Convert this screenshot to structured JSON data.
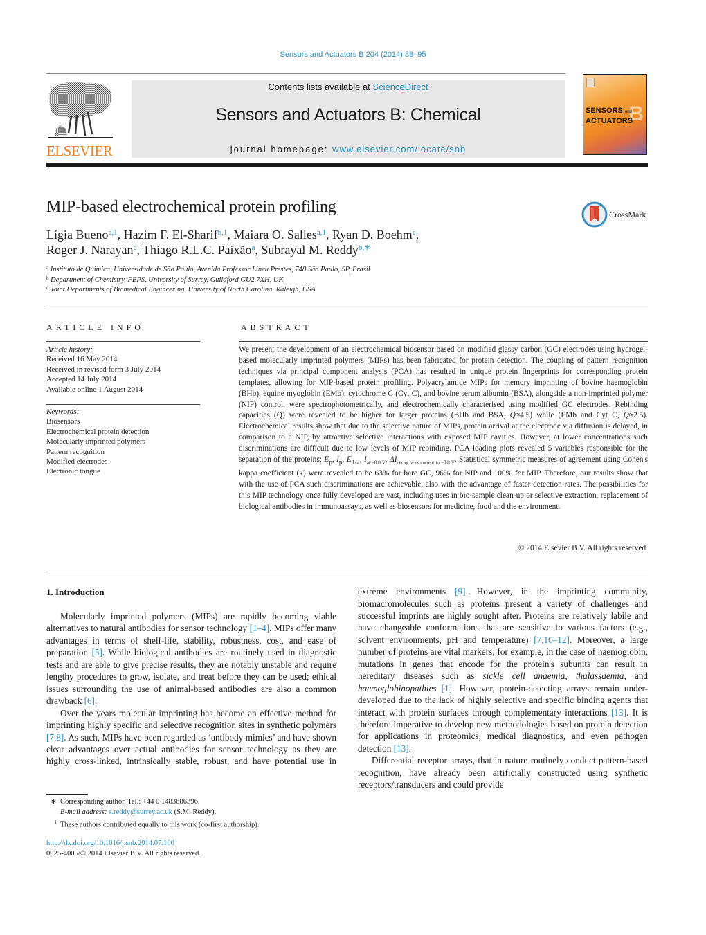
{
  "header": {
    "citation": "Sensors and Actuators B 204 (2014) 88–95",
    "contents_prefix": "Contents lists available at ",
    "contents_link": "ScienceDirect",
    "journal_title": "Sensors and Actuators B: Chemical",
    "homepage_prefix": "journal homepage: ",
    "homepage_link": "www.elsevier.com/locate/snb",
    "publisher_logo_text": "ELSEVIER",
    "cover": {
      "line1": "SENSORS",
      "line1_small": "and",
      "line2": "ACTUATORS",
      "letter": "B"
    },
    "colors": {
      "link": "#2a8fbf",
      "elsevier_orange": "#f07d1e",
      "header_box": "#e8e8e8"
    }
  },
  "article": {
    "title": "MIP-based electrochemical protein profiling",
    "crossmark_label": "CrossMark",
    "authors": [
      {
        "name": "Lígia Bueno",
        "sup": "a,1",
        "sep": ", "
      },
      {
        "name": "Hazim F. El-Sharif",
        "sup": "b,1",
        "sep": ", "
      },
      {
        "name": "Maiara O. Salles",
        "sup": "a,1",
        "sep": ", "
      },
      {
        "name": "Ryan D. Boehm",
        "sup": "c",
        "sep": ","
      },
      {
        "name": "Roger J. Narayan",
        "sup": "c",
        "sep": ", "
      },
      {
        "name": "Thiago R.L.C. Paixão",
        "sup": "a",
        "sep": ", "
      },
      {
        "name": "Subrayal M. Reddy",
        "sup": "b,∗",
        "sep": ""
      }
    ],
    "affiliations": [
      {
        "key": "a",
        "text": "Instituto de Quimica, Universidade de São Paulo, Avenida Professor Lineu Prestes, 748 São Paulo, SP, Brasil"
      },
      {
        "key": "b",
        "text": "Department of Chemistry, FEPS, University of Surrey, Guildford GU2 7XH, UK"
      },
      {
        "key": "c",
        "text": "Joint Departments of Biomedical Engineering, University of North Carolina, Raleigh, USA"
      }
    ]
  },
  "article_info": {
    "heading": "ARTICLE INFO",
    "history_label": "Article history:",
    "history": [
      "Received 16 May 2014",
      "Received in revised form 3 July 2014",
      "Accepted 14 July 2014",
      "Available online 1 August 2014"
    ],
    "keywords_label": "Keywords:",
    "keywords": [
      "Biosensors",
      "Electrochemical protein detection",
      "Molecularly imprinted polymers",
      "Pattern recognition",
      "Modified electrodes",
      "Electronic tongue"
    ]
  },
  "abstract": {
    "heading": "ABSTRACT",
    "part1": "We present the development of an electrochemical biosensor based on modified glassy carbon (GC) electrodes using hydrogel-based molecularly imprinted polymers (MIPs) has been fabricated for protein detection. The coupling of pattern recognition techniques via principal component analysis (PCA) has resulted in unique protein fingerprints for corresponding protein templates, allowing for MIP-based protein profiling. Polyacrylamide MIPs for memory imprinting of bovine haemoglobin (BHb), equine myoglobin (EMb), cytochrome C (Cyt C), and bovine serum albumin (BSA), alongside a non-imprinted polymer (NIP) control, were spectrophotometrically, and electrochemically characterised using modified GC electrodes. Rebinding capacities (Q) were revealed to be higher for larger proteins (BHb and BSA, ",
    "q1": "Q",
    "q1_val": "≈4.5) while (EMb and Cyt C, ",
    "q2": "Q",
    "q2_val": "≈2.5). Electrochemical results show that due to the selective nature of MIPs, protein arrival at the electrode via diffusion is delayed, in comparison to a NIP, by attractive selective interactions with exposed MIP cavities. However, at lower concentrations such discriminations are difficult due to low levels of MIP rebinding. PCA loading plots revealed 5 variables responsible for the separation of the proteins; ",
    "vars": {
      "ep": "E",
      "ep_sub": "p",
      "ip": "I",
      "ip_sub": "p",
      "e12": "E",
      "e12_sub": "1/2",
      "iat": "I",
      "iat_sub": "at −0.8 V",
      "di": "ΔI",
      "di_sub": "decay peak current to −0.8 V"
    },
    "part2": ". Statistical symmetric measures of agreement using Cohen's kappa coefficient (κ) were revealed to be 63% for bare GC, 96% for NIP and 100% for MIP. Therefore, our results show that with the use of PCA such discriminations are achievable, also with the advantage of faster detection rates. The possibilities for this MIP technology once fully developed are vast, including uses in bio-sample clean-up or selective extraction, replacement of biological antibodies in immunoassays, as well as biosensors for medicine, food and the environment.",
    "copyright": "© 2014 Elsevier B.V. All rights reserved."
  },
  "introduction": {
    "heading": "1.  Introduction",
    "p1": [
      {
        "t": "Molecularly imprinted polymers (MIPs) are rapidly becoming viable alternatives to natural antibodies for sensor technology "
      },
      {
        "ref": "[1–4]"
      },
      {
        "t": ". MIPs offer many advantages in terms of shelf-life, stability, robustness, cost, and ease of preparation "
      },
      {
        "ref": "[5]"
      },
      {
        "t": ". While biological antibodies are routinely used in diagnostic tests and are able to give precise results, they are notably unstable and require lengthy procedures to grow, isolate, and treat before they can be used; ethical issues surrounding the use of animal-based antibodies are also a common drawback "
      },
      {
        "ref": "[6]"
      },
      {
        "t": "."
      }
    ],
    "p2": [
      {
        "t": "Over the years molecular imprinting has become an effective method for imprinting highly specific and selective recognition sites in synthetic polymers "
      },
      {
        "ref": "[7,8]"
      },
      {
        "t": ". As such, MIPs have been regarded as ‘antibody mimics’ and have shown clear advantages over actual antibodies for sensor technology as they are highly cross-linked, intrinsically stable, robust, and have potential use in extreme environments "
      },
      {
        "ref": "[9]"
      },
      {
        "t": ". However, in the imprinting community, biomacromolecules such as proteins present a variety of challenges and successful imprints are highly sought after. Proteins are relatively labile and have changeable conformations that are sensitive to various factors (e.g., solvent environments, pH and temperature) "
      },
      {
        "ref": "[7,10–12]"
      },
      {
        "t": ". Moreover, a large number of proteins are vital markers; for example, in the case of haemoglobin, mutations in genes that encode for the protein's subunits can result in hereditary diseases such as "
      },
      {
        "em": "sickle cell anaemia"
      },
      {
        "t": ", "
      },
      {
        "em": "thalassaemia"
      },
      {
        "t": ", and "
      },
      {
        "em": "haemoglobinopathies"
      },
      {
        "t": " "
      },
      {
        "ref": "[1]"
      },
      {
        "t": ". However, protein-detecting arrays remain under-developed due to the lack of highly selective and specific binding agents that interact with protein surfaces through complementary interactions "
      },
      {
        "ref": "[13]"
      },
      {
        "t": ". It is therefore imperative to develop new methodologies based on protein detection for applications in proteomics, medical diagnostics, and even pathogen detection "
      },
      {
        "ref": "[13]"
      },
      {
        "t": "."
      }
    ],
    "p3": [
      {
        "t": "Differential receptor arrays, that in nature routinely conduct pattern-based recognition, have already been artificially constructed using synthetic receptors/transducers and could provide"
      }
    ]
  },
  "footnotes": {
    "corresponding_mark": "∗",
    "corresponding": "Corresponding author. Tel.: +44 0 1483686396.",
    "email_label": "E-mail address:",
    "email": "s.reddy@surrey.ac.uk",
    "email_suffix": " (S.M. Reddy).",
    "equal_mark": "1",
    "equal": "These authors contributed equally to this work (co-first authorship).",
    "doi": "http://dx.doi.org/10.1016/j.snb.2014.07.100",
    "issn": "0925-4005/© 2014 Elsevier B.V. All rights reserved."
  }
}
